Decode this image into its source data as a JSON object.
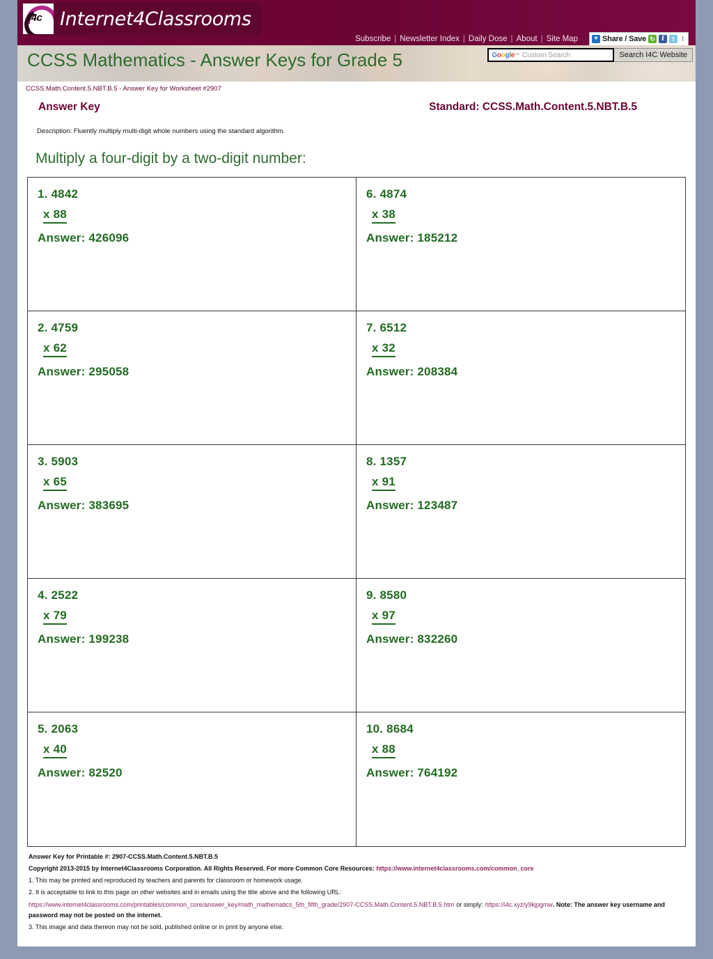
{
  "site": {
    "brand_name": "Internet4Classrooms",
    "logo_text": "i4c",
    "nav": [
      {
        "label": "Subscribe"
      },
      {
        "label": "Newsletter Index"
      },
      {
        "label": "Daily Dose"
      },
      {
        "label": "About"
      },
      {
        "label": "Site Map"
      }
    ],
    "nav_separator": "|",
    "share": {
      "label": "Share / Save",
      "plus": "+",
      "icons": [
        "addthis-icon",
        "facebook-icon",
        "twitter-icon",
        "more-options-icon"
      ],
      "facebook_glyph": "f",
      "twitter_glyph": "t",
      "addthis_glyph": "↻",
      "more_glyph": "↕"
    },
    "search": {
      "google_g": "G",
      "google_o1": "o",
      "google_o2": "o",
      "google_g2": "g",
      "google_l": "l",
      "google_e": "e",
      "trademark": "™",
      "placeholder": "Custom Search",
      "button_label": "Search I4C Website"
    }
  },
  "hero": {
    "title": "CCSS Mathematics - Answer Keys for Grade 5"
  },
  "subcaption": "CCSS.Math.Content.5.NBT.B.5 - Answer Key for Worksheet #2907",
  "header": {
    "answer_key_label": "Answer Key",
    "standard_label": "Standard: CCSS.Math.Content.5.NBT.B.5",
    "description": "Description: Fluently multiply multi-digit whole numbers using the standard algorithm."
  },
  "instruction": "Multiply a four-digit by a two-digit number:",
  "problems": [
    {
      "num": "1.",
      "multiplicand": "4842",
      "multiplier": "x  88",
      "answer": "Answer: 426096"
    },
    {
      "num": "6.",
      "multiplicand": "4874",
      "multiplier": "x  38",
      "answer": "Answer: 185212"
    },
    {
      "num": "2.",
      "multiplicand": "4759",
      "multiplier": "x  62",
      "answer": "Answer: 295058"
    },
    {
      "num": "7.",
      "multiplicand": "6512",
      "multiplier": "x  32",
      "answer": "Answer: 208384"
    },
    {
      "num": "3.",
      "multiplicand": "5903",
      "multiplier": "x  65",
      "answer": "Answer: 383695"
    },
    {
      "num": "8.",
      "multiplicand": "1357",
      "multiplier": "x  91",
      "answer": "Answer: 123487"
    },
    {
      "num": "4.",
      "multiplicand": "2522",
      "multiplier": "x  79",
      "answer": "Answer: 199238"
    },
    {
      "num": "9.",
      "multiplicand": "8580",
      "multiplier": "x  97",
      "answer": "Answer: 832260"
    },
    {
      "num": "5.",
      "multiplicand": "2063",
      "multiplier": "x  40",
      "answer": "Answer: 82520"
    },
    {
      "num": "10.",
      "multiplicand": "8684",
      "multiplier": "x  88",
      "answer": "Answer: 764192"
    }
  ],
  "problem_cells": [
    {
      "label_1": "1. 4842"
    },
    {
      "label_6": "6. 4874"
    }
  ],
  "footer": {
    "printable_line": "Answer Key for Printable #: 2907-CCSS.Math.Content.5.NBT.B.5",
    "copyright_prefix": "Copyright 2013-2015 by Internet4Classrooms Corporation. All Rights Reserved. For more Common Core Resources:",
    "copyright_link": "https://www.internet4classrooms.com/common_core",
    "note_1": "1. This may be printed and reproduced by teachers and parents for classroom or homework usage.",
    "note_2": "2. It is acceptable to link to this page on other websites and in emails using the title above and the following URL:",
    "long_url": "https://www.internet4classrooms.com/printables/common_core/answer_key/math_mathematics_5th_fifth_grade/2907-CCSS.Math.Content.5.NBT.B.5.htm",
    "or_simply": "or simply:",
    "short_url": "https://i4c.xyz/y9kjpgmw",
    "note_suffix": ". Note: The answer key username and password may not be posted on the internet.",
    "note_3": "3. This image and data thereon may not be sold, published online or in print by anyone else."
  },
  "colors": {
    "maroon": "#6b0536",
    "green": "#226b22",
    "hero_green": "#2f6b2f",
    "link": "#8c2a62",
    "page_bg": "#8d9bb2"
  }
}
